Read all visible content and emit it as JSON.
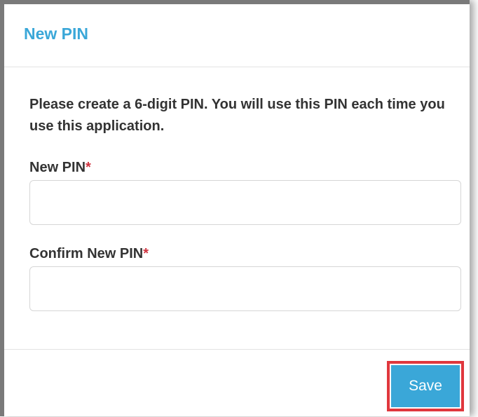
{
  "dialog": {
    "title": "New PIN",
    "instructions": "Please create a 6-digit PIN. You will use this PIN each time you use this application.",
    "fields": [
      {
        "label": "New PIN",
        "required_mark": "*",
        "value": ""
      },
      {
        "label": "Confirm New PIN",
        "required_mark": "*",
        "value": ""
      }
    ],
    "save_label": "Save"
  },
  "colors": {
    "accent": "#3aa7d8",
    "required": "#d0333f",
    "highlight_border": "#e0373d"
  }
}
